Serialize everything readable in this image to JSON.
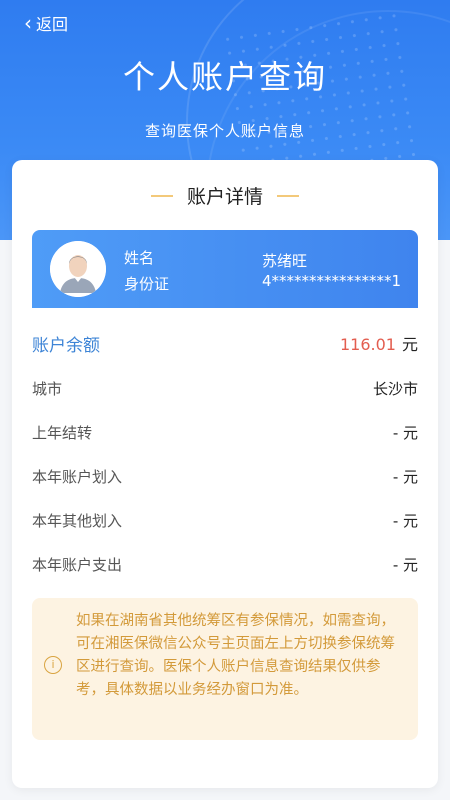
{
  "header": {
    "back_label": "返回",
    "title": "个人账户查询",
    "subtitle": "查询医保个人账户信息"
  },
  "card": {
    "title": "账户详情",
    "id_card": {
      "name_label": "姓名",
      "name_value": "苏绪旺",
      "id_label": "身份证",
      "id_value": "4****************1"
    },
    "balance": {
      "label": "账户余额",
      "amount": "116.01",
      "unit": "元"
    },
    "rows": [
      {
        "label": "城市",
        "value": "长沙市"
      },
      {
        "label": "上年结转",
        "value": "- 元"
      },
      {
        "label": "本年账户划入",
        "value": "- 元"
      },
      {
        "label": "本年其他划入",
        "value": "- 元"
      },
      {
        "label": "本年账户支出",
        "value": "- 元"
      }
    ],
    "notice": "如果在湖南省其他统筹区有参保情况，如需查询，可在湘医保微信公众号主页面左上方切换参保统筹区进行查询。医保个人账户信息查询结果仅供参考，具体数据以业务经办窗口为准。"
  },
  "colors": {
    "primary": "#2f7cf0",
    "balance_label": "#3d84d6",
    "amount": "#e35d4f",
    "notice_bg": "#fdf3e2",
    "notice_text": "#d39a3a"
  },
  "icons": [
    "back-chevron-icon",
    "avatar-icon",
    "info-icon"
  ]
}
